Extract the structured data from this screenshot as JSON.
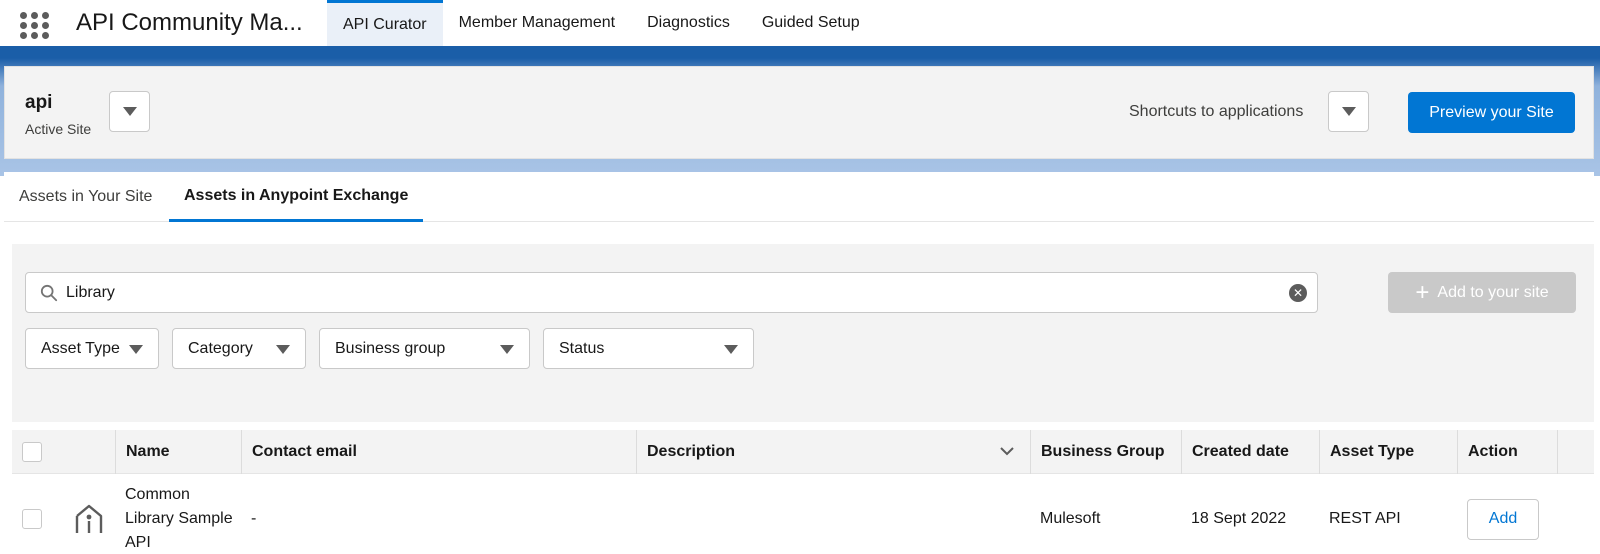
{
  "app": {
    "title": "API Community Ma..."
  },
  "nav": {
    "tabs": [
      {
        "label": "API Curator",
        "active": true
      },
      {
        "label": "Member Management",
        "active": false
      },
      {
        "label": "Diagnostics",
        "active": false
      },
      {
        "label": "Guided Setup",
        "active": false
      }
    ]
  },
  "site": {
    "name": "api",
    "status": "Active Site",
    "shortcuts_label": "Shortcuts to applications",
    "preview_label": "Preview your Site"
  },
  "sub_tabs": [
    {
      "label": "Assets in Your Site",
      "active": false
    },
    {
      "label": "Assets in Anypoint Exchange",
      "active": true
    }
  ],
  "search": {
    "value": "Library"
  },
  "add_to_site_label": "Add to your site",
  "filters": [
    {
      "label": "Asset Type"
    },
    {
      "label": "Category"
    },
    {
      "label": "Business group"
    },
    {
      "label": "Status"
    }
  ],
  "table": {
    "columns": [
      "Name",
      "Contact email",
      "Description",
      "Business Group",
      "Created date",
      "Asset Type",
      "Action"
    ],
    "rows": [
      {
        "name": "Common Library Sample API",
        "contact_email": "-",
        "description": "",
        "business_group": "Mulesoft",
        "created_date": "18 Sept 2022",
        "asset_type": "REST API",
        "action": "Add"
      }
    ]
  },
  "colors": {
    "brand": "#0176d3",
    "header_blue": "#1a5ea8",
    "disabled": "#c9c9c9"
  }
}
